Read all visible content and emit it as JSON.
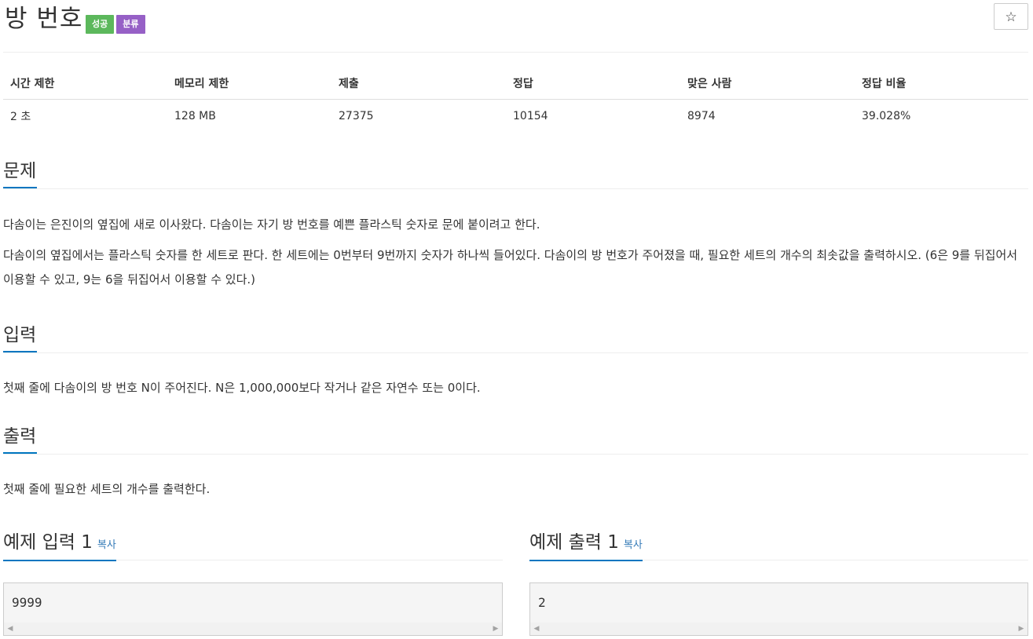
{
  "header": {
    "title": "방 번호",
    "badges": {
      "success": "성공",
      "category": "분류"
    },
    "star_icon": "☆"
  },
  "info_table": {
    "headers": [
      "시간 제한",
      "메모리 제한",
      "제출",
      "정답",
      "맞은 사람",
      "정답 비율"
    ],
    "values": [
      "2 초",
      "128 MB",
      "27375",
      "10154",
      "8974",
      "39.028%"
    ]
  },
  "sections": {
    "problem": {
      "title": "문제",
      "paragraphs": [
        "다솜이는 은진이의 옆집에 새로 이사왔다. 다솜이는 자기 방 번호를 예쁜 플라스틱 숫자로 문에 붙이려고 한다.",
        "다솜이의 옆집에서는 플라스틱 숫자를 한 세트로 판다. 한 세트에는 0번부터 9번까지 숫자가 하나씩 들어있다. 다솜이의 방 번호가 주어졌을 때, 필요한 세트의 개수의 최솟값을 출력하시오. (6은 9를 뒤집어서 이용할 수 있고, 9는 6을 뒤집어서 이용할 수 있다.)"
      ]
    },
    "input": {
      "title": "입력",
      "paragraphs": [
        "첫째 줄에 다솜이의 방 번호 N이 주어진다. N은 1,000,000보다 작거나 같은 자연수 또는 0이다."
      ]
    },
    "output": {
      "title": "출력",
      "paragraphs": [
        "첫째 줄에 필요한 세트의 개수를 출력한다."
      ]
    }
  },
  "samples": {
    "input": {
      "title": "예제 입력 1",
      "copy_label": "복사",
      "content": "9999"
    },
    "output": {
      "title": "예제 출력 1",
      "copy_label": "복사",
      "content": "2"
    }
  },
  "colors": {
    "success_badge": "#5cb85c",
    "category_badge": "#9660c6",
    "accent_underline": "#0076c0",
    "link": "#337ab7"
  },
  "icons": {
    "star": "star-icon",
    "scroll_left": "scroll-left-arrow-icon",
    "scroll_right": "scroll-right-arrow-icon"
  }
}
